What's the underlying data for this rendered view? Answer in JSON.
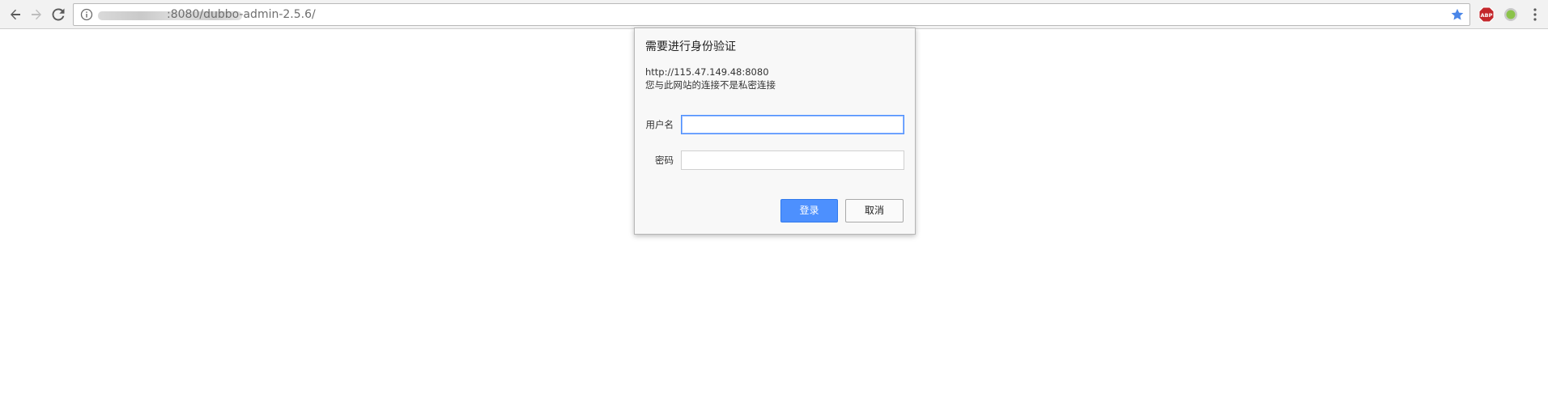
{
  "browser": {
    "back_icon": "arrow-left-icon",
    "forward_icon": "arrow-right-icon",
    "reload_icon": "reload-icon",
    "info_icon": "info-circle-icon",
    "bookmark_icon": "star-icon",
    "extensions": [
      {
        "name": "abp-icon",
        "label": "ABP",
        "color": "#c3272b"
      },
      {
        "name": "green-circle-icon",
        "color": "#8bc34a"
      }
    ],
    "menu_icon": "three-dots-vertical-icon",
    "url_visible": ":8080/dubbo-admin-2.5.6/",
    "accent_color": "#4a86e8"
  },
  "auth_dialog": {
    "title": "需要进行身份验证",
    "origin": "http://115.47.149.48:8080",
    "warning": "您与此网站的连接不是私密连接",
    "username_label": "用户名",
    "username_value": "",
    "password_label": "密码",
    "password_value": "",
    "login_button": "登录",
    "cancel_button": "取消",
    "primary_color": "#4d90fe"
  }
}
